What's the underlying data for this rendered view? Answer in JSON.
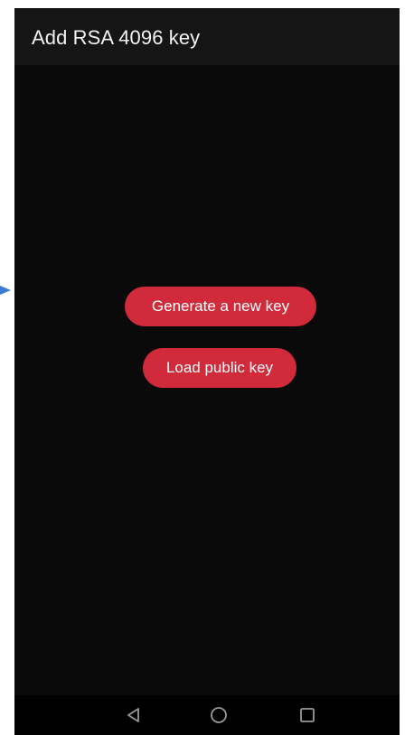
{
  "app_bar": {
    "title": "Add RSA 4096 key"
  },
  "actions": {
    "generate_label": "Generate a new key",
    "load_label": "Load public key"
  },
  "navigation": {
    "back_icon": "back-triangle-icon",
    "home_icon": "home-circle-icon",
    "recents_icon": "recents-square-icon"
  },
  "colors": {
    "accent": "#d12a3a",
    "background": "#0a0a0a",
    "app_bar": "#151515",
    "title_text": "#f2f2f2",
    "button_text": "#ffffff",
    "nav_bar": "#000000",
    "nav_icon": "#9a9a9a",
    "marker": "#3b7bd6"
  }
}
